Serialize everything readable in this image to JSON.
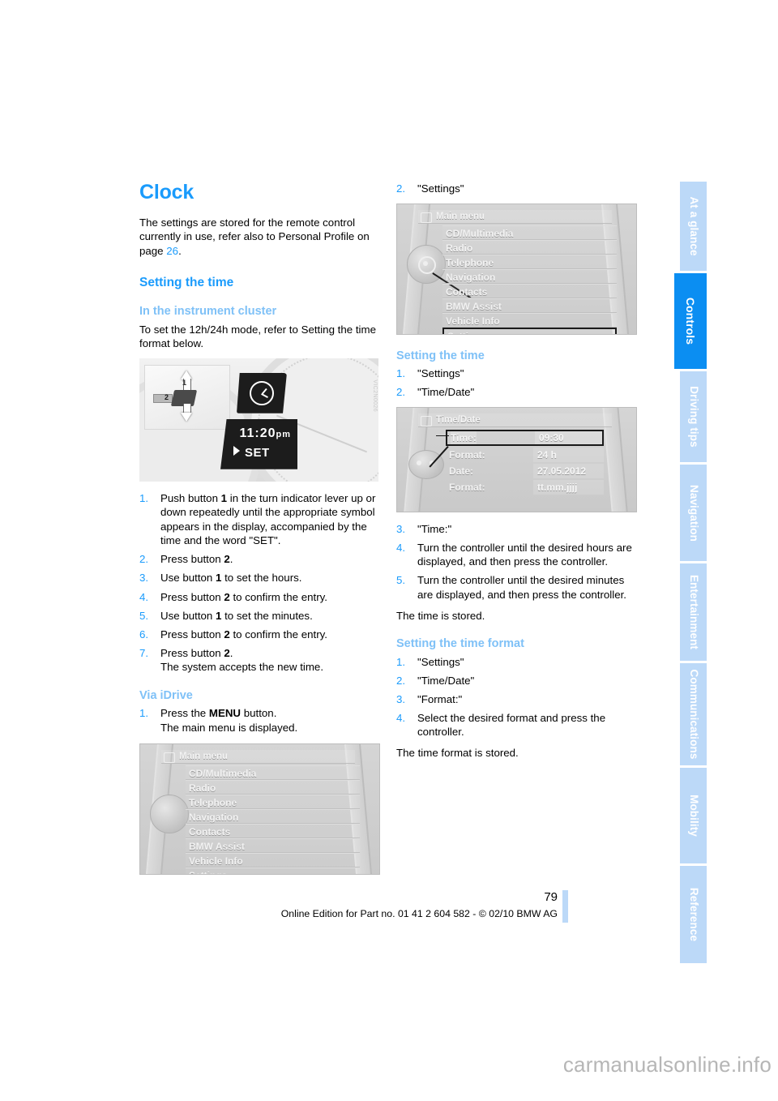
{
  "document": {
    "page_number": "79",
    "footer_line": "Online Edition for Part no. 01 41 2 604 582 - © 02/10 BMW AG",
    "watermark": "carmanualsonline.info"
  },
  "colors": {
    "heading_blue": "#1a9bfc",
    "subheading_blue": "#7fc1f7",
    "tab_active": "#0b8ef2",
    "tab_inactive": "#bcd9f8"
  },
  "tabs": [
    {
      "label": "At a glance",
      "active": false
    },
    {
      "label": "Controls",
      "active": true
    },
    {
      "label": "Driving tips",
      "active": false
    },
    {
      "label": "Navigation",
      "active": false
    },
    {
      "label": "Entertainment",
      "active": false
    },
    {
      "label": "Communications",
      "active": false
    },
    {
      "label": "Mobility",
      "active": false
    },
    {
      "label": "Reference",
      "active": false
    }
  ],
  "left_column": {
    "title": "Clock",
    "intro_part1": "The settings are stored for the remote control currently in use, refer also to Personal Profile on page ",
    "intro_page_ref": "26",
    "intro_part2": ".",
    "section_setting_time": "Setting the time",
    "subsection_cluster": "In the instrument cluster",
    "cluster_intro": "To set the 12h/24h mode, refer to Setting the time format below.",
    "cluster_figure": {
      "time": "11:20",
      "ampm": "pm",
      "set_label": "SET",
      "callout_1": "1",
      "callout_2": "2",
      "code": "VIC2N0026"
    },
    "cluster_steps": [
      {
        "text_before": "Push button ",
        "bold": "1",
        "text_after": " in the turn indicator lever up or down repeatedly until the appropriate symbol appears in the display, accompanied by the time and the word \"SET\"."
      },
      {
        "text_before": "Press button ",
        "bold": "2",
        "text_after": "."
      },
      {
        "text_before": "Use button ",
        "bold": "1",
        "text_after": " to set the hours."
      },
      {
        "text_before": "Press button ",
        "bold": "2",
        "text_after": " to confirm the entry."
      },
      {
        "text_before": "Use button ",
        "bold": "1",
        "text_after": " to set the minutes."
      },
      {
        "text_before": "Press button ",
        "bold": "2",
        "text_after": " to confirm the entry."
      },
      {
        "text_before": "Press button ",
        "bold": "2",
        "text_after": ".",
        "extra": "The system accepts the new time."
      }
    ],
    "subsection_idrive": "Via iDrive",
    "idrive_steps": [
      {
        "text_before": "Press the ",
        "bold": "MENU",
        "text_after": " button.",
        "extra": "The main menu is displayed."
      }
    ],
    "main_menu_figure": {
      "header": "Main menu",
      "items": [
        "CD/Multimedia",
        "Radio",
        "Telephone",
        "Navigation",
        "Contacts",
        "BMW Assist",
        "Vehicle Info",
        "Settings"
      ],
      "selected": null
    }
  },
  "right_column": {
    "step2_number": "2.",
    "step2_label": "\"Settings\"",
    "main_menu_figure": {
      "header": "Main menu",
      "items": [
        "CD/Multimedia",
        "Radio",
        "Telephone",
        "Navigation",
        "Contacts",
        "BMW Assist",
        "Vehicle Info",
        "Settings"
      ],
      "selected": "Settings"
    },
    "section_setting_time": "Setting the time",
    "setting_time_steps": [
      {
        "text_after": "\"Settings\""
      },
      {
        "text_after": "\"Time/Date\""
      }
    ],
    "time_date_figure": {
      "header": "Time/Date",
      "rows": [
        {
          "label": "Time:",
          "value": "09:30",
          "selected": true
        },
        {
          "label": "Format:",
          "value": "24 h",
          "selected": false
        },
        {
          "label": "Date:",
          "value": "27.05.2012",
          "selected": false
        },
        {
          "label": "Format:",
          "value": "tt.mm.jjjj",
          "selected": false
        }
      ]
    },
    "setting_time_steps_cont": [
      {
        "text_after": "\"Time:\""
      },
      {
        "text_after": "Turn the controller until the desired hours are displayed, and then press the controller."
      },
      {
        "text_after": "Turn the controller until the desired minutes are displayed, and then press the controller."
      }
    ],
    "time_stored": "The time is stored.",
    "section_time_format": "Setting the time format",
    "time_format_steps": [
      {
        "text_after": "\"Settings\""
      },
      {
        "text_after": "\"Time/Date\""
      },
      {
        "text_after": "\"Format:\""
      },
      {
        "text_after": "Select the desired format and press the controller."
      }
    ],
    "time_format_stored": "The time format is stored."
  }
}
